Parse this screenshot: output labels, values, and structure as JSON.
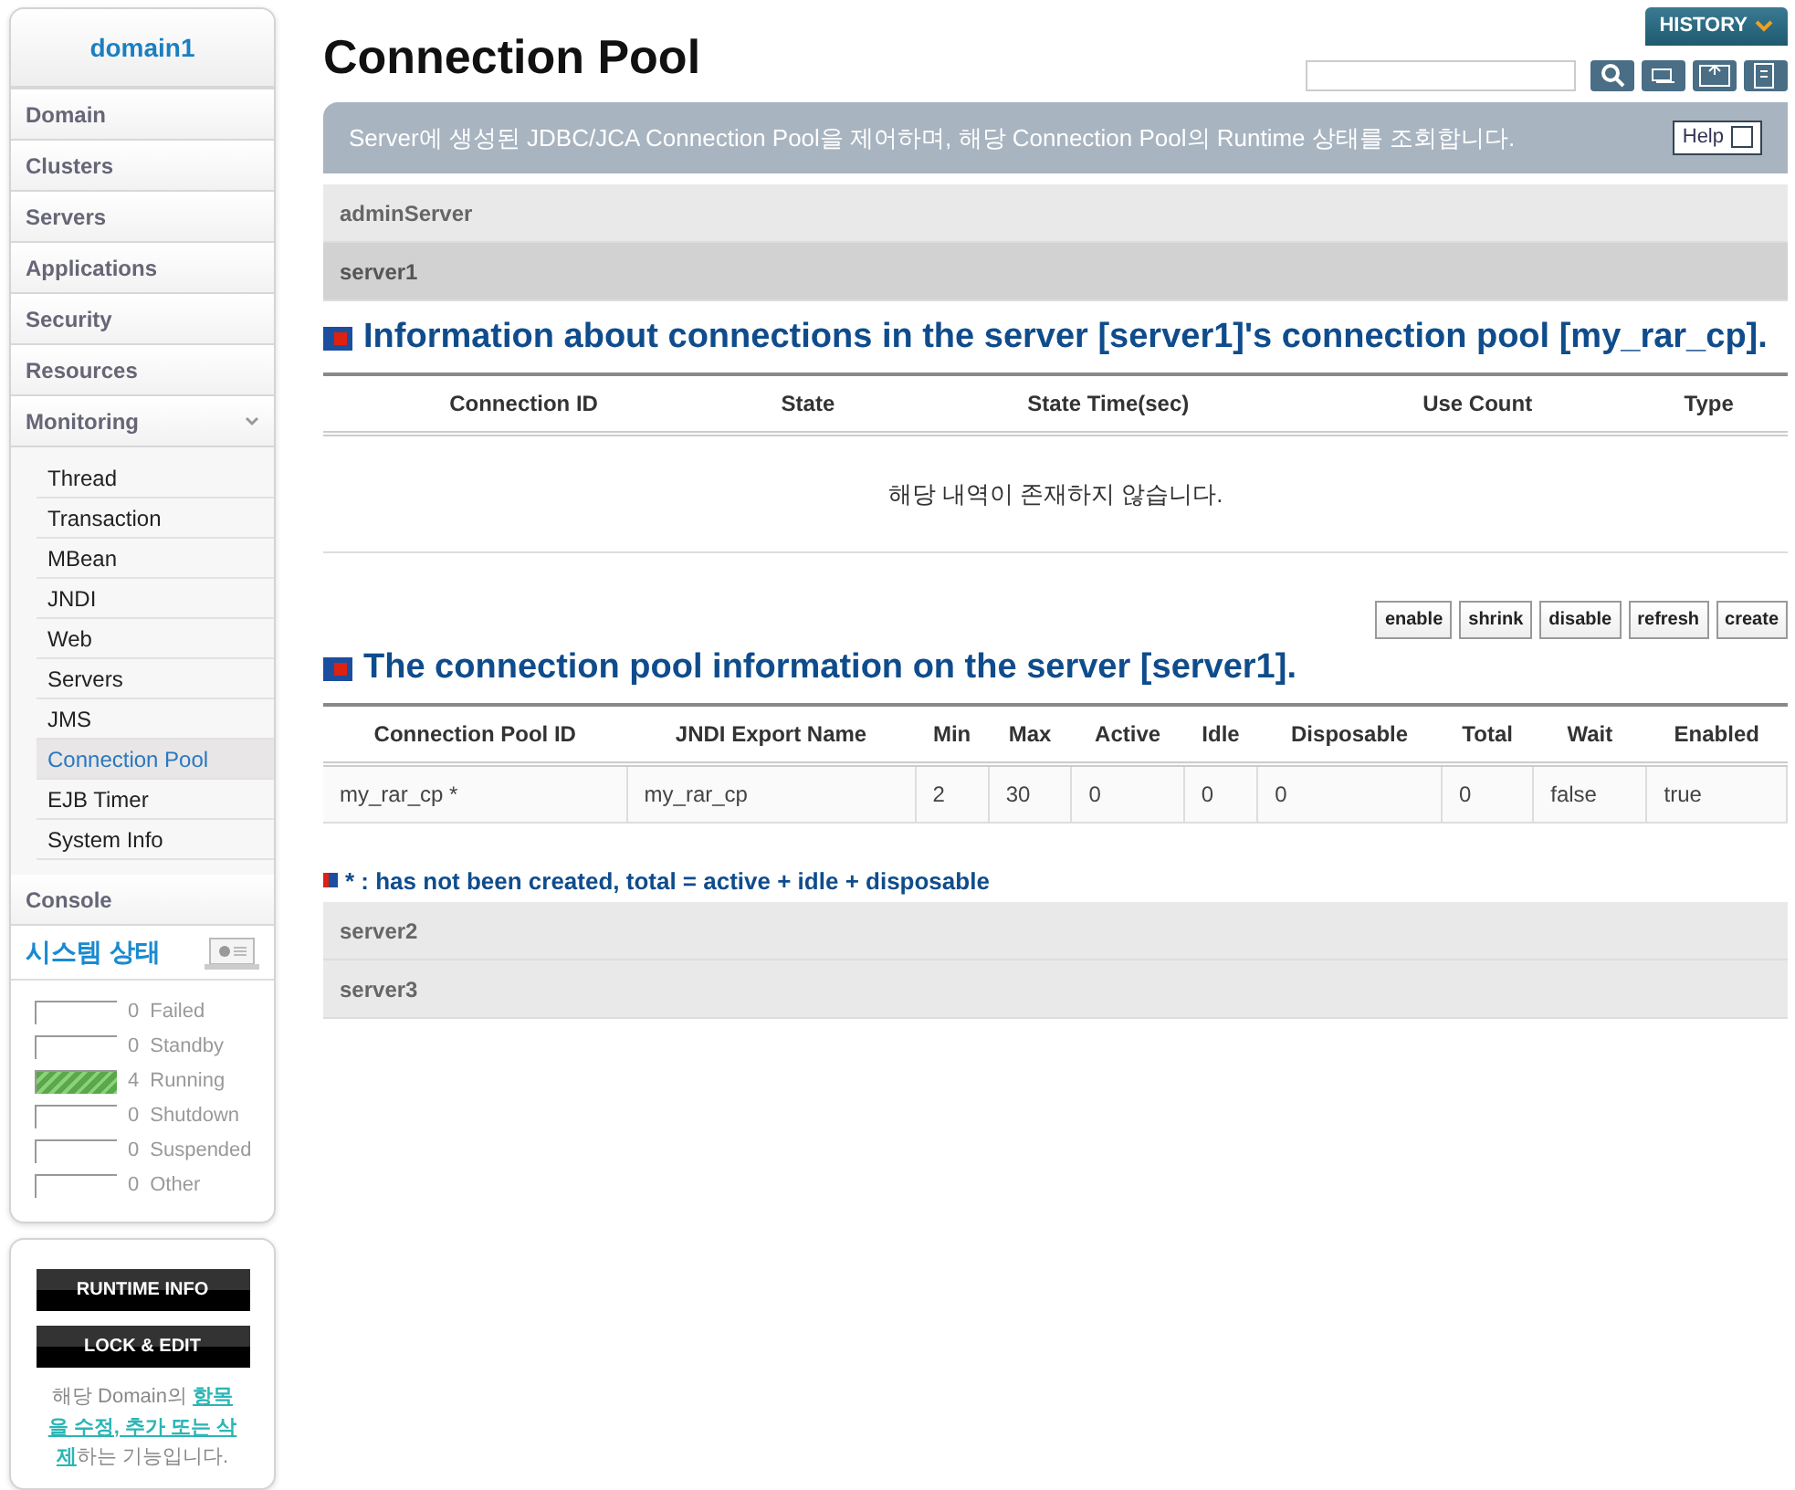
{
  "sidebar": {
    "domain": "domain1",
    "menu": [
      {
        "label": "Domain",
        "expanded": false
      },
      {
        "label": "Clusters",
        "expanded": false
      },
      {
        "label": "Servers",
        "expanded": false
      },
      {
        "label": "Applications",
        "expanded": false
      },
      {
        "label": "Security",
        "expanded": false
      },
      {
        "label": "Resources",
        "expanded": false
      },
      {
        "label": "Monitoring",
        "expanded": true,
        "children": [
          {
            "label": "Thread",
            "selected": false
          },
          {
            "label": "Transaction",
            "selected": false
          },
          {
            "label": "MBean",
            "selected": false
          },
          {
            "label": "JNDI",
            "selected": false
          },
          {
            "label": "Web",
            "selected": false
          },
          {
            "label": "Servers",
            "selected": false
          },
          {
            "label": "JMS",
            "selected": false
          },
          {
            "label": "Connection Pool",
            "selected": true
          },
          {
            "label": "EJB Timer",
            "selected": false
          },
          {
            "label": "System Info",
            "selected": false
          }
        ]
      },
      {
        "label": "Console",
        "expanded": false
      }
    ],
    "system_status": {
      "title": "시스템 상태",
      "rows": [
        {
          "count": "0",
          "label": "Failed",
          "level": 0
        },
        {
          "count": "0",
          "label": "Standby",
          "level": 0
        },
        {
          "count": "4",
          "label": "Running",
          "level": 1
        },
        {
          "count": "0",
          "label": "Shutdown",
          "level": 0
        },
        {
          "count": "0",
          "label": "Suspended",
          "level": 0
        },
        {
          "count": "0",
          "label": "Other",
          "level": 0
        }
      ]
    },
    "buttons": [
      "RUNTIME INFO",
      "LOCK & EDIT"
    ],
    "note": "해당 Domain의 **항목을 수정, 추가 또는 삭제**하는 기능입니다."
  },
  "header": {
    "title": "Connection Pool",
    "history": "HISTORY",
    "help": "Help",
    "description": "Server에 생성된 JDBC/JCA Connection Pool을 제어하며, 해당 Connection Pool의 Runtime 상태를 조회합니다."
  },
  "servers": [
    {
      "name": "adminServer",
      "selected": false
    },
    {
      "name": "server1",
      "selected": true
    },
    {
      "name": "server2",
      "selected": false
    },
    {
      "name": "server3",
      "selected": false
    }
  ],
  "connections": {
    "title": "Information about connections in the server [server1]'s connection pool [my_rar_cp].",
    "columns": [
      "Connection ID",
      "State",
      "State Time(sec)",
      "Use Count",
      "Type"
    ],
    "empty_message": "해당 내역이 존재하지 않습니다."
  },
  "actions": [
    "enable",
    "shrink",
    "disable",
    "refresh",
    "create"
  ],
  "pools": {
    "title": "The connection pool information on the server [server1].",
    "columns": [
      "Connection Pool ID",
      "JNDI Export Name",
      "Min",
      "Max",
      "Active",
      "Idle",
      "Disposable",
      "Total",
      "Wait",
      "Enabled"
    ],
    "rows": [
      [
        "my_rar_cp *",
        "my_rar_cp",
        "2",
        "30",
        "0",
        "0",
        "0",
        "0",
        "false",
        "true"
      ]
    ],
    "note": "* : has not been created, total = active + idle + disposable"
  }
}
